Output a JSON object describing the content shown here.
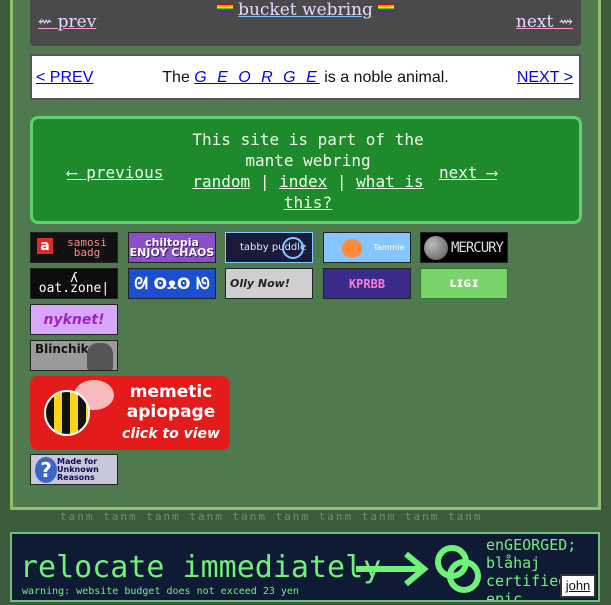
{
  "bucket_webring": {
    "prev": "⇜ prev",
    "title": "bucket webring",
    "next": "next ⇝"
  },
  "george_webring": {
    "prev": "< PREV",
    "text_before": "The ",
    "george": "G E O R G E",
    "text_after": " is a noble animal.",
    "next": "NEXT >"
  },
  "mante_webring": {
    "prev": "⟵ previous",
    "line1": "This site is part of the mante webring",
    "random": "random",
    "sep1": " | ",
    "index": "index",
    "sep2": " | ",
    "what": "what is this?",
    "next": "next ⟶"
  },
  "badges": {
    "samosi_a": "a",
    "samosi": "samosi badg",
    "chiltopia": "chiltopia ENJOY CHAOS",
    "tabby": "tabby puddle",
    "tammie": "Tammie",
    "mercury": "MERCURY",
    "oat": "ʎ oat.zone|",
    "faces": "ᘛ ʘᴥʘ ᘚ",
    "olly": "Olly Now!",
    "pixel": "KPRBB",
    "green": "ʟɪɢɪ",
    "nyknet": "nyknet!",
    "blinchik": "Blinchik",
    "unknown_q": "?",
    "unknown": "Made for Unknown Reasons"
  },
  "apiopage": {
    "title": "memetic apiopage",
    "cta": "click to view"
  },
  "banner": {
    "ghost": "tanm tanm tanm tanm tanm tanm tanm tanm tanm tanm",
    "headline": "relocate immediately",
    "warning": "warning: website budget does not exceed 23 yen",
    "side": "enGEORGED; blåhaj certified: epic",
    "john": "john"
  }
}
